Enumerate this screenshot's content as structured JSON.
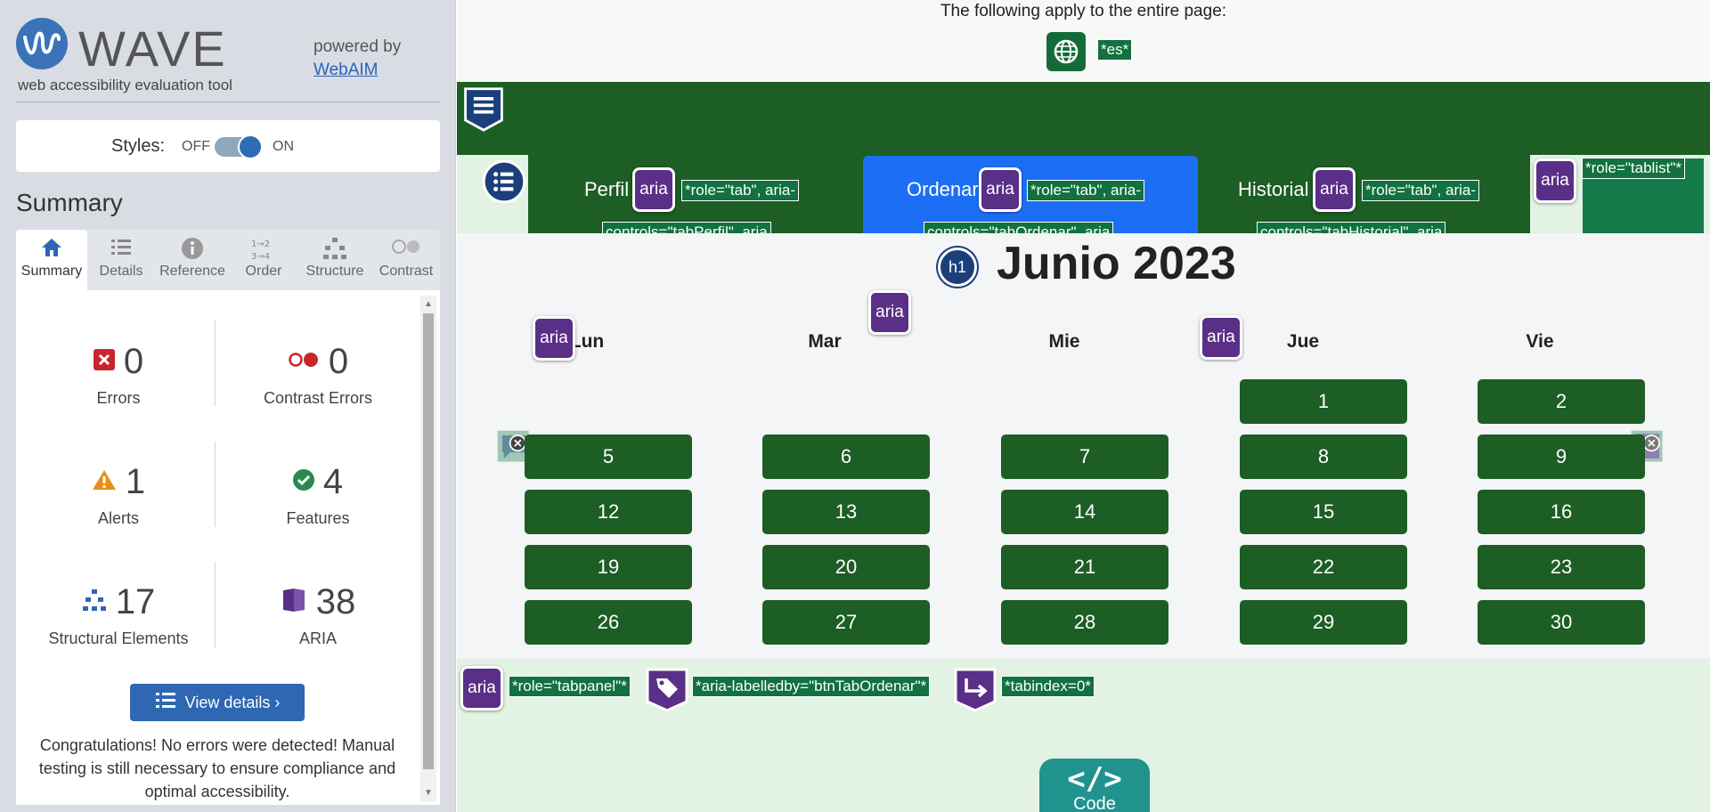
{
  "wave": {
    "logo_word": "WAVE",
    "tagline": "web accessibility evaluation tool",
    "powered_by": "powered by",
    "webaim_link": "WebAIM",
    "styles_label": "Styles:",
    "off_label": "OFF",
    "on_label": "ON",
    "summary_heading": "Summary",
    "tabs": [
      {
        "label": "Summary",
        "icon": "home-icon"
      },
      {
        "label": "Details",
        "icon": "list-icon"
      },
      {
        "label": "Reference",
        "icon": "info-icon"
      },
      {
        "label": "Order",
        "icon": "order-icon"
      },
      {
        "label": "Structure",
        "icon": "hierarchy-icon"
      },
      {
        "label": "Contrast",
        "icon": "contrast-icon"
      }
    ],
    "stats": {
      "errors": {
        "value": "0",
        "label": "Errors"
      },
      "contrast_errors": {
        "value": "0",
        "label": "Contrast Errors"
      },
      "alerts": {
        "value": "1",
        "label": "Alerts"
      },
      "features": {
        "value": "4",
        "label": "Features"
      },
      "structural": {
        "value": "17",
        "label": "Structural Elements"
      },
      "aria": {
        "value": "38",
        "label": "ARIA"
      }
    },
    "view_details": "View details ›",
    "congrats": "Congratulations! No errors were detected! Manual testing is still necessary to ensure compliance and optimal accessibility."
  },
  "page": {
    "note": "The following apply to the entire page:",
    "lang_tag": "*es*",
    "nav_tabs": [
      {
        "label": "Perfil",
        "aria": "aria",
        "tag": "*role=\"tab\", aria-",
        "tag2": "controls=\"tabPerfil\", aria"
      },
      {
        "label": "Ordenar",
        "aria": "aria",
        "tag": "*role=\"tab\", aria-",
        "tag2": "controls=\"tabOrdenar\", aria"
      },
      {
        "label": "Historial",
        "aria": "aria",
        "tag": "*role=\"tab\", aria-",
        "tag2": "controls=\"tabHistorial\", aria"
      }
    ],
    "tablist_aria": "aria",
    "tablist_tag": "*role=\"tablist\"*",
    "h1_badge": "h1",
    "title": "Junio 2023",
    "day_heads": [
      "Lun",
      "Mar",
      "Mie",
      "Jue",
      "Vie"
    ],
    "aria_badge": "aria",
    "weeks": [
      [
        "",
        "",
        "",
        "1",
        "2"
      ],
      [
        "5",
        "6",
        "7",
        "8",
        "9"
      ],
      [
        "12",
        "13",
        "14",
        "15",
        "16"
      ],
      [
        "19",
        "20",
        "21",
        "22",
        "23"
      ],
      [
        "26",
        "27",
        "28",
        "29",
        "30"
      ]
    ],
    "bottom_tags": {
      "role": "*role=\"tabpanel\"*",
      "labelledby": "*aria-labelledby=\"btnTabOrdenar\"*",
      "tabindex": "*tabindex=0*"
    },
    "code_glyph": "</>",
    "code_label": "Code"
  },
  "colors": {
    "nav_green": "#1d5e24",
    "active_tab_blue": "#1c6ff5",
    "wave_blue": "#2f67b3",
    "aria_purple": "#5a2f87",
    "tag_green": "#11713f"
  }
}
